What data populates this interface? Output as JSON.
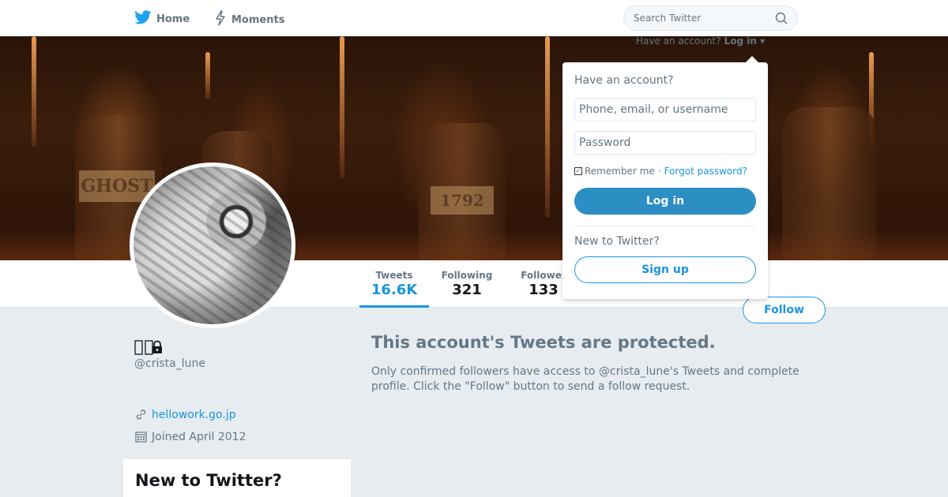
{
  "nav": {
    "home_label": "Home",
    "moments_label": "Moments",
    "search_placeholder": "Search Twitter"
  },
  "header_login": {
    "prompt": "Have an account?",
    "link": "Log in",
    "caret": "▾"
  },
  "banner": {
    "label_1": "GHOST",
    "label_2": "1792"
  },
  "stats": {
    "tweets": {
      "label": "Tweets",
      "value": "16.6K"
    },
    "following": {
      "label": "Following",
      "value": "321"
    },
    "followers": {
      "label": "Follower",
      "value": "133"
    }
  },
  "profile": {
    "handle": "@crista_lune",
    "website": "hellowork.go.jp",
    "joined": "Joined April 2012"
  },
  "follow_button": "Follow",
  "protected": {
    "title": "This account's Tweets are protected.",
    "text": "Only confirmed followers have access to @crista_lune's Tweets and complete profile. Click the \"Follow\" button to send a follow request."
  },
  "signup_module": {
    "title": "New to Twitter?"
  },
  "login_dropdown": {
    "heading": "Have an account?",
    "username_placeholder": "Phone, email, or username",
    "password_placeholder": "Password",
    "remember_label": "Remember me",
    "separator": "·",
    "forgot_label": "Forgot password?",
    "login_button": "Log in",
    "new_prompt": "New to Twitter?",
    "signup_button": "Sign up"
  },
  "colors": {
    "accent": "#1b95e0",
    "login_button": "#2b8fc4",
    "background": "#e6ecf0"
  }
}
